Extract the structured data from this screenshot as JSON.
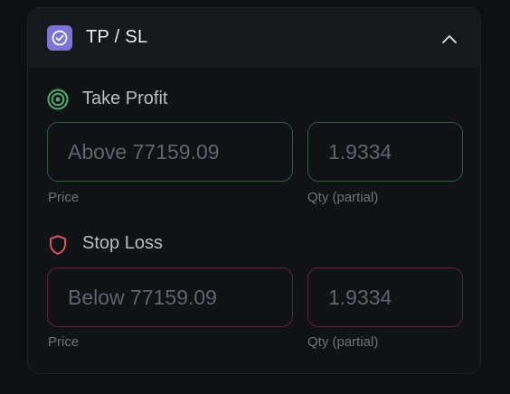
{
  "header": {
    "title": "TP / SL",
    "icon": "check-circle-icon",
    "accent": "#7b73d9",
    "collapse_icon": "chevron-up-icon"
  },
  "take_profit": {
    "title": "Take Profit",
    "icon": "target-icon",
    "color": "#4caf6e",
    "price_placeholder": "Above 77159.09",
    "qty_placeholder": "1.9334",
    "price_label": "Price",
    "qty_label": "Qty (partial)"
  },
  "stop_loss": {
    "title": "Stop Loss",
    "icon": "shield-icon",
    "color": "#e0525f",
    "price_placeholder": "Below 77159.09",
    "qty_placeholder": "1.9334",
    "price_label": "Price",
    "qty_label": "Qty (partial)"
  }
}
